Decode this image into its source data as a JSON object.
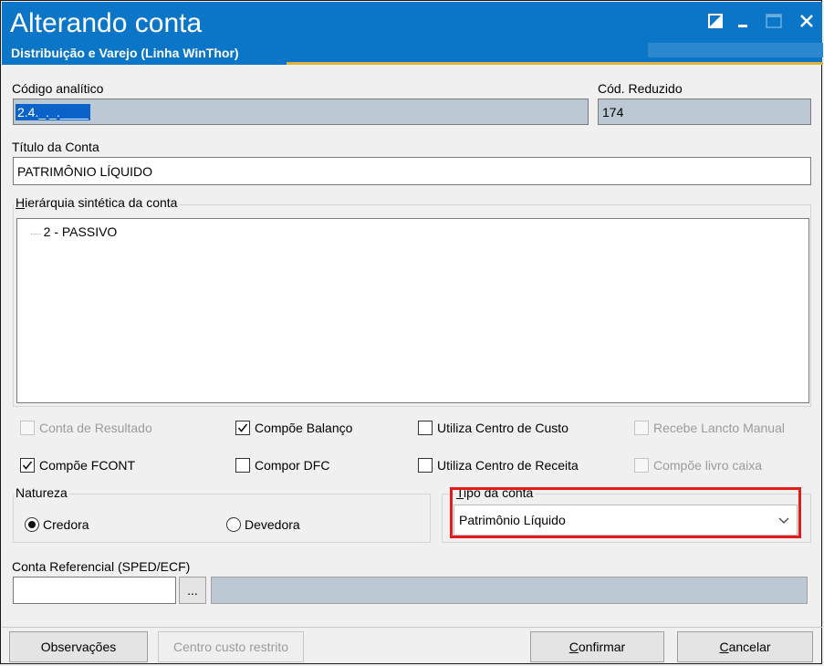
{
  "window": {
    "title": "Alterando conta",
    "subtitle": "Distribuição e Varejo (Linha WinThor)",
    "accent": "#0b76c7",
    "controls": [
      "restore-icon",
      "minimize-icon",
      "maximize-icon",
      "close-icon"
    ]
  },
  "codigo_analitico": {
    "label": "Código analítico",
    "value": "2.4._._.____"
  },
  "cod_reduzido": {
    "label": "Cód. Reduzido",
    "value": "174"
  },
  "titulo_conta": {
    "label": "Título da Conta",
    "value": "PATRIMÔNIO LÍQUIDO"
  },
  "hierarquia": {
    "label": "Hierárquia sintética da conta",
    "items": [
      "2 - PASSIVO"
    ]
  },
  "checkboxes": {
    "conta_resultado": {
      "label": "Conta de Resultado",
      "checked": false,
      "enabled": false
    },
    "compoe_balanco": {
      "label": "Compõe Balanço",
      "checked": true,
      "enabled": true
    },
    "utiliza_centro_custo": {
      "label": "Utiliza Centro de Custo",
      "checked": false,
      "enabled": true
    },
    "recebe_lancto_manual": {
      "label": "Recebe Lancto Manual",
      "checked": false,
      "enabled": false
    },
    "compoe_fcont": {
      "label": "Compõe FCONT",
      "checked": true,
      "enabled": true
    },
    "compor_dfc": {
      "label": "Compor DFC",
      "checked": false,
      "enabled": true
    },
    "utiliza_centro_receita": {
      "label": "Utiliza Centro de Receita",
      "checked": false,
      "enabled": true
    },
    "compoe_livro_caixa": {
      "label": "Compõe livro caixa",
      "checked": false,
      "enabled": false
    }
  },
  "natureza": {
    "label": "Natureza",
    "options": {
      "credora": "Credora",
      "devedora": "Devedora"
    },
    "selected": "Credora"
  },
  "tipo_conta": {
    "label": "Tipo da conta",
    "value": "Patrimônio Líquido",
    "highlight": "#e31b1b"
  },
  "conta_referencial": {
    "label": "Conta Referencial (SPED/ECF)",
    "code": "",
    "description": "",
    "lookup_label": "..."
  },
  "buttons": {
    "observacoes": "Observações",
    "centro_custo_restrito": "Centro custo restrito",
    "confirmar": "Confirmar",
    "cancelar": "Cancelar"
  }
}
